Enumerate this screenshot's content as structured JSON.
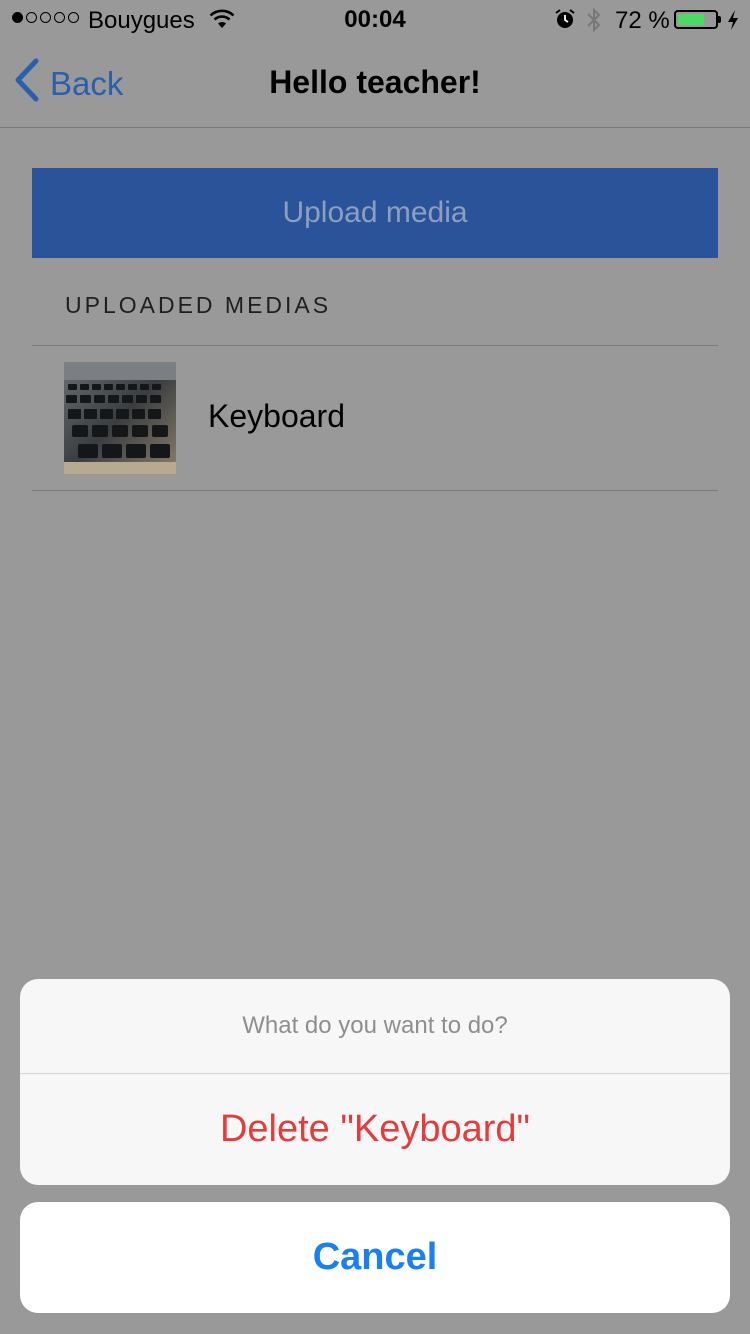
{
  "status_bar": {
    "carrier": "Bouygues",
    "time": "00:04",
    "battery_percent": "72 %",
    "battery_level": 0.72,
    "signal_bars_filled": 1,
    "signal_bars_total": 5
  },
  "nav": {
    "back_label": "Back",
    "title": "Hello teacher!"
  },
  "upload_button_label": "Upload media",
  "section_header": "UPLOADED MEDIAS",
  "media_items": [
    {
      "label": "Keyboard",
      "icon": "keyboard-thumbnail"
    }
  ],
  "action_sheet": {
    "title": "What do you want to do?",
    "delete_label": "Delete \"Keyboard\"",
    "cancel_label": "Cancel"
  },
  "colors": {
    "accent_blue": "#1a7ff0",
    "upload_bg": "#2a539a",
    "destructive_red": "#e63b3b",
    "battery_green": "#4cd964"
  }
}
